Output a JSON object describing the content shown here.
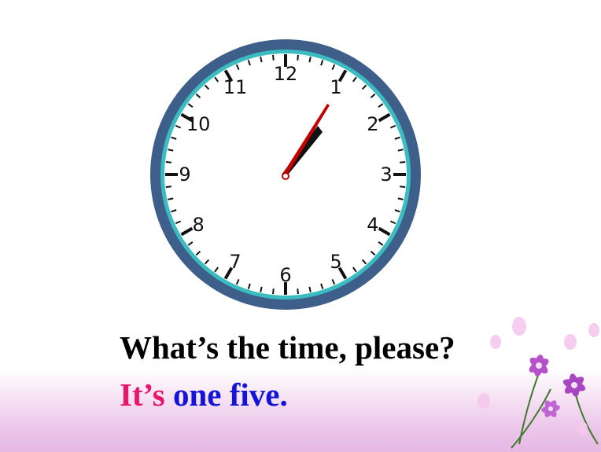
{
  "clock": {
    "numerals": [
      "12",
      "1",
      "2",
      "3",
      "4",
      "5",
      "6",
      "7",
      "8",
      "9",
      "10",
      "11"
    ],
    "time_shown": "1:05",
    "colors": {
      "rim": "#3e5f8a",
      "inner_ring": "#3bbcc0",
      "hour_hand": "#111111",
      "minute_hand": "#c00000"
    }
  },
  "question": "What’s the time, please?",
  "answer": {
    "lead": "It’s",
    "rest": "one five."
  },
  "colors": {
    "answer_lead": "#e8176c",
    "answer_rest": "#1414d8",
    "band": "#ecc7ea"
  }
}
